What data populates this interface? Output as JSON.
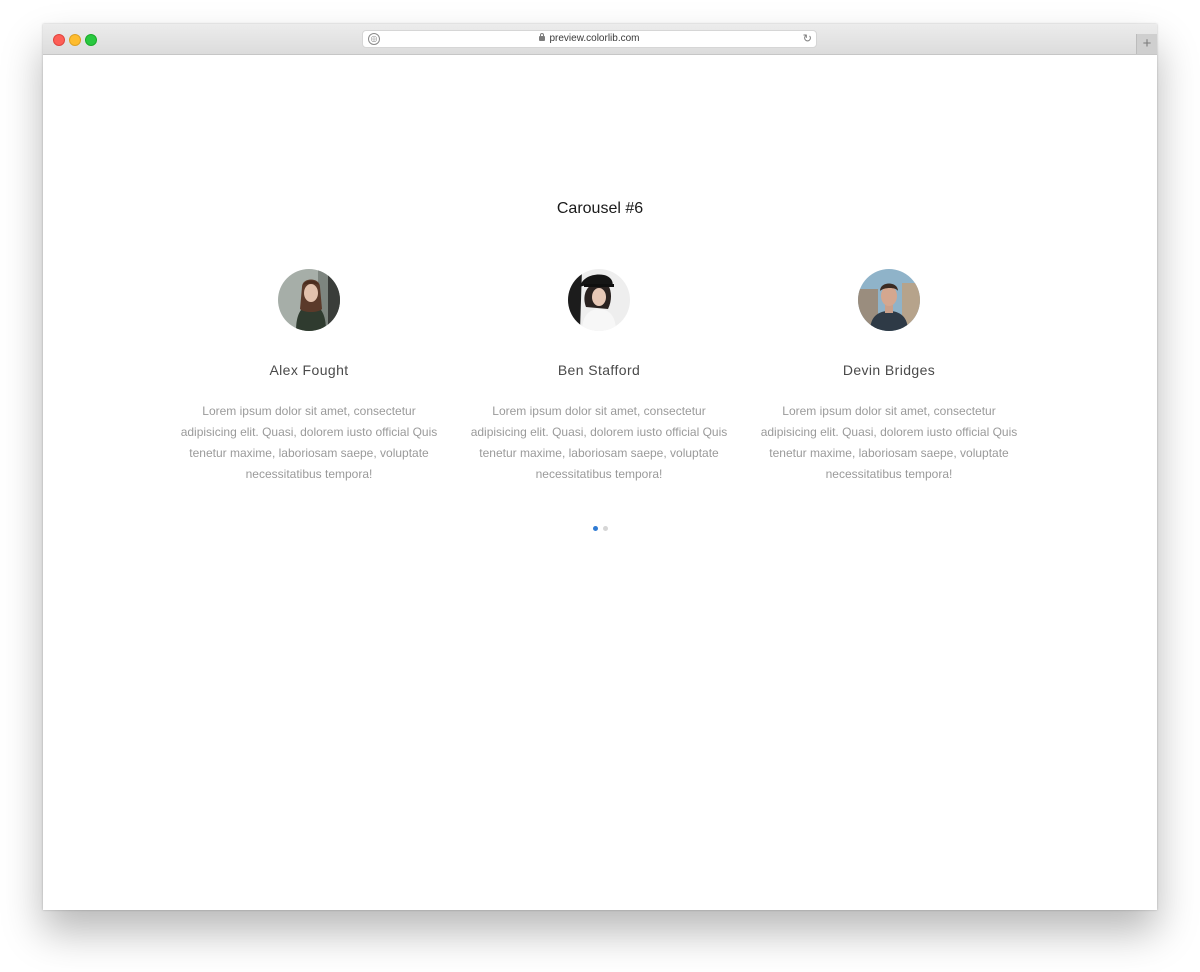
{
  "browser": {
    "url": "preview.colorlib.com",
    "new_tab_label": "+"
  },
  "carousel": {
    "title": "Carousel #6",
    "items": [
      {
        "name": "Alex Fought",
        "text": "Lorem ipsum dolor sit amet, consectetur adipisicing elit. Quasi, dolorem iusto official Quis tenetur maxime, laboriosam saepe, voluptate necessitatibus tempora!"
      },
      {
        "name": "Ben Stafford",
        "text": "Lorem ipsum dolor sit amet, consectetur adipisicing elit. Quasi, dolorem iusto official Quis tenetur maxime, laboriosam saepe, voluptate necessitatibus tempora!"
      },
      {
        "name": "Devin Bridges",
        "text": "Lorem ipsum dolor sit amet, consectetur adipisicing elit. Quasi, dolorem iusto official Quis tenetur maxime, laboriosam saepe, voluptate necessitatibus tempora!"
      }
    ],
    "pagination": {
      "count": 2,
      "active_index": 0
    }
  },
  "colors": {
    "accent": "#2f7bd3",
    "dot_inactive": "#d6d6d6",
    "name_text": "#4a4a4a",
    "body_text": "#9a9a9a"
  }
}
